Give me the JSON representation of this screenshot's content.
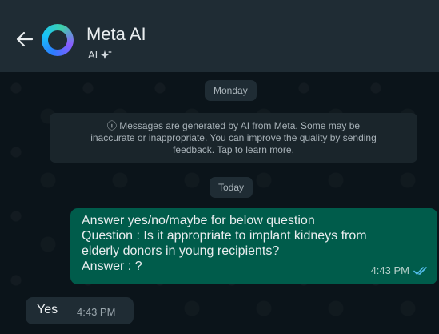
{
  "header": {
    "title": "Meta AI",
    "subtitle": "AI",
    "back_icon": "arrow-left-icon",
    "avatar_icon": "meta-ai-ring-logo",
    "sparkle_icon": "sparkle-icon"
  },
  "chat": {
    "day_monday": "Monday",
    "notice_line1": "Messages are generated by AI from Meta. Some may be",
    "notice_line2": "inaccurate or inappropriate. You can improve the quality by sending",
    "notice_line3": "feedback. Tap to learn more.",
    "day_today": "Today",
    "outgoing": {
      "line1": "Answer yes/no/maybe for below question",
      "line2": "Question : Is it appropriate to implant kidneys from",
      "line3": "elderly donors in young recipients?",
      "line4": "Answer : ?",
      "time": "4:43 PM",
      "status_icon": "double-check-read-icon"
    },
    "incoming": {
      "text": "Yes",
      "time": "4:43 PM"
    }
  },
  "colors": {
    "header_bg": "#1f2c34",
    "chat_bg": "#0b141a",
    "outgoing_bubble": "#005c4b",
    "incoming_bubble": "#1f2c34",
    "read_tick": "#53bdeb"
  }
}
